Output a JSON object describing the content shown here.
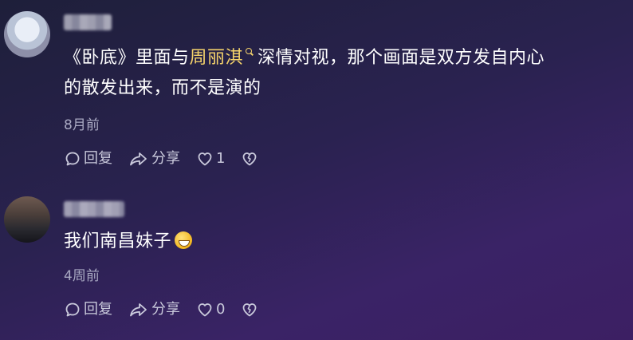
{
  "comments": [
    {
      "text_lines": [
        {
          "before": "《卧底》里面与",
          "mention": "周丽淇",
          "after": "深情对视，那个画面是双方发自内心"
        },
        {
          "text": "的散发出来，而不是演的"
        }
      ],
      "time": "8月前",
      "actions": {
        "reply": "回复",
        "share": "分享",
        "like_count": "1"
      }
    },
    {
      "text": "我们南昌妹子",
      "emoji_icon": "grinning-face-emoji",
      "time": "4周前",
      "actions": {
        "reply": "回复",
        "share": "分享",
        "like_count": "0"
      }
    }
  ],
  "colors": {
    "mention": "#f5d36b",
    "secondary_text": "#a9a9c2",
    "action_text": "#c9c9db"
  }
}
